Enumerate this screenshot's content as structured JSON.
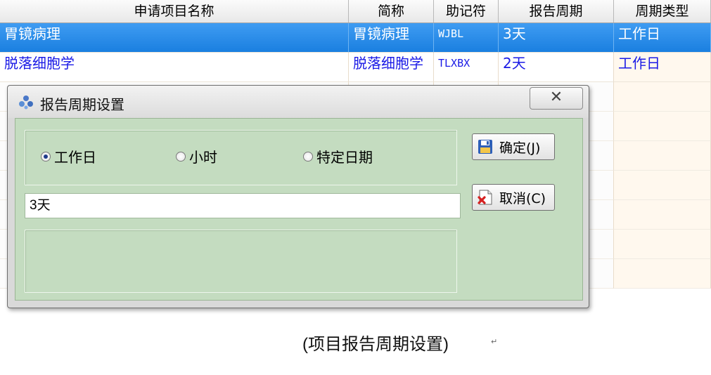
{
  "grid": {
    "headers": [
      "申请项目名称",
      "简称",
      "助记符",
      "报告周期",
      "周期类型"
    ],
    "rows": [
      {
        "name": "胃镜病理",
        "short": "胃镜病理",
        "mnemonic": "WJBL",
        "period": "3天",
        "type": "工作日"
      },
      {
        "name": "脱落细胞学",
        "short": "脱落细胞学",
        "mnemonic": "TLXBX",
        "period": "2天",
        "type": "工作日"
      }
    ],
    "selected_row": 0
  },
  "dialog": {
    "title": "报告周期设置",
    "close_icon": "close-icon",
    "radios": [
      {
        "label": "工作日",
        "checked": true
      },
      {
        "label": "小时",
        "checked": false
      },
      {
        "label": "特定日期",
        "checked": false
      }
    ],
    "value": "3天",
    "ok_label": "确定(J)",
    "cancel_label": "取消(C)",
    "ok_icon": "save-icon",
    "cancel_icon": "cancel-icon"
  },
  "caption": "(项目报告周期设置)",
  "colors": {
    "selection": "#1a7fe0",
    "row_text": "#1a1ae6",
    "dialog_client": "#c4dcc0"
  }
}
